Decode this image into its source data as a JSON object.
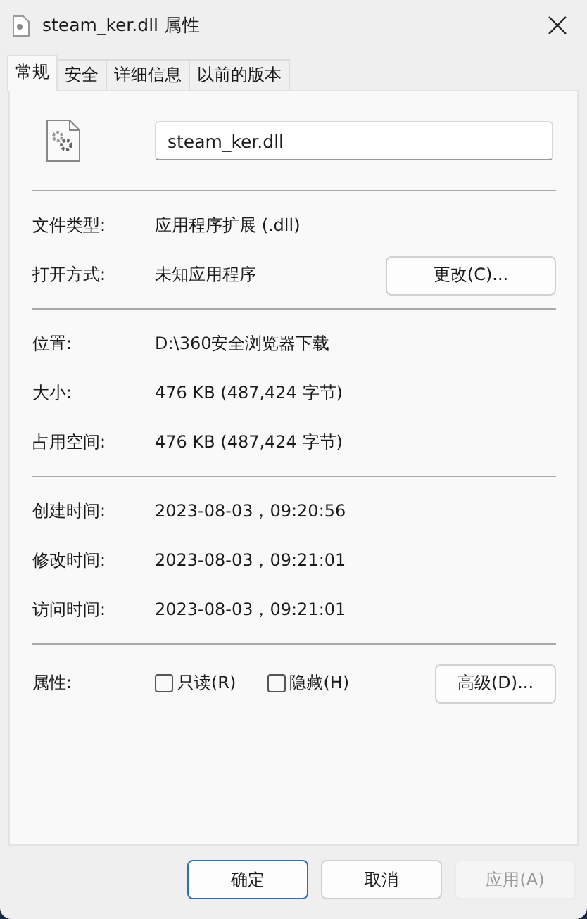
{
  "window": {
    "title": "steam_ker.dll 属性"
  },
  "tabs": [
    {
      "label": "常规",
      "selected": true
    },
    {
      "label": "安全",
      "selected": false
    },
    {
      "label": "详细信息",
      "selected": false
    },
    {
      "label": "以前的版本",
      "selected": false
    }
  ],
  "file_name": "steam_ker.dll",
  "sections": [
    [
      {
        "label": "文件类型:",
        "value": "应用程序扩展 (.dll)"
      },
      {
        "label": "打开方式:",
        "value": "未知应用程序",
        "button": "更改(C)..."
      }
    ],
    [
      {
        "label": "位置:",
        "value": "D:\\360安全浏览器下载"
      },
      {
        "label": "大小:",
        "value": "476 KB (487,424 字节)"
      },
      {
        "label": "占用空间:",
        "value": "476 KB (487,424 字节)"
      }
    ],
    [
      {
        "label": "创建时间:",
        "value": "2023-08-03，09:20:56"
      },
      {
        "label": "修改时间:",
        "value": "2023-08-03，09:21:01"
      },
      {
        "label": "访问时间:",
        "value": "2023-08-03，09:21:01"
      }
    ]
  ],
  "attributes": {
    "label": "属性:",
    "checkboxes": [
      {
        "label": "只读(R)",
        "checked": false
      },
      {
        "label": "隐藏(H)",
        "checked": false
      }
    ],
    "button": "高级(D)..."
  },
  "buttons": [
    {
      "label": "确定",
      "default": true,
      "disabled": false
    },
    {
      "label": "取消",
      "default": false,
      "disabled": false
    },
    {
      "label": "应用(A)",
      "default": false,
      "disabled": true
    }
  ]
}
